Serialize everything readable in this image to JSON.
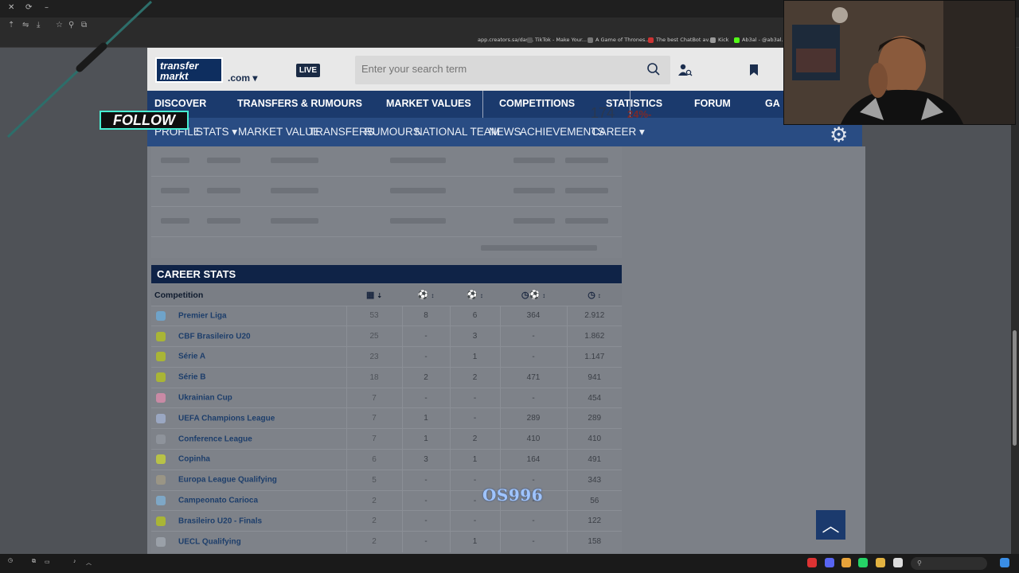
{
  "browser": {
    "bookmarks": [
      "app.creators.sa/das...",
      "TikTok - Make Your...",
      "A Game of Thrones...",
      "The best ChatBot av...",
      "Kick",
      "Ab3al - @ab3al..."
    ]
  },
  "header": {
    "logo_line1": "transfer",
    "logo_line2": "markt",
    "domain": ".com",
    "live_label": "LIVE",
    "search_placeholder": "Enter your search term"
  },
  "main_nav": [
    "DISCOVER",
    "TRANSFERS & RUMOURS",
    "MARKET VALUES",
    "COMPETITIONS",
    "STATISTICS",
    "FORUM",
    "GA"
  ],
  "sub_nav": [
    "PROFILE",
    "STATS ▾",
    "MARKET VALUE",
    "TRANSFERS",
    "RUMOURS",
    "NATIONAL TEAM",
    "NEWS",
    "ACHIEVEMENTS",
    "CAREER ▾"
  ],
  "overlay": {
    "follow_label": "FOLLOW",
    "watermark": "OS996",
    "ad_number": "174",
    "ad_percent": "24%-"
  },
  "career_stats": {
    "title": "CAREER STATS",
    "column_header": "Competition",
    "rows": [
      {
        "name": "Premier Liga",
        "apps": "53",
        "goals": "8",
        "assists": "6",
        "mpg": "364",
        "minutes": "2.912",
        "color": "#6fa3c9"
      },
      {
        "name": "CBF Brasileiro U20",
        "apps": "25",
        "goals": "-",
        "assists": "3",
        "mpg": "-",
        "minutes": "1.862",
        "color": "#a9b536"
      },
      {
        "name": "Série A",
        "apps": "23",
        "goals": "-",
        "assists": "1",
        "mpg": "-",
        "minutes": "1.147",
        "color": "#a9b536"
      },
      {
        "name": "Série B",
        "apps": "18",
        "goals": "2",
        "assists": "2",
        "mpg": "471",
        "minutes": "941",
        "color": "#a9b536"
      },
      {
        "name": "Ukrainian Cup",
        "apps": "7",
        "goals": "-",
        "assists": "-",
        "mpg": "-",
        "minutes": "454",
        "color": "#c98aa5"
      },
      {
        "name": "UEFA Champions League",
        "apps": "7",
        "goals": "1",
        "assists": "-",
        "mpg": "289",
        "minutes": "289",
        "color": "#9aa7c2"
      },
      {
        "name": "Conference League",
        "apps": "7",
        "goals": "1",
        "assists": "2",
        "mpg": "410",
        "minutes": "410",
        "color": "#8e939b"
      },
      {
        "name": "Copinha",
        "apps": "6",
        "goals": "3",
        "assists": "1",
        "mpg": "164",
        "minutes": "491",
        "color": "#b8c247"
      },
      {
        "name": "Europa League Qualifying",
        "apps": "5",
        "goals": "-",
        "assists": "-",
        "mpg": "-",
        "minutes": "343",
        "color": "#9a9585"
      },
      {
        "name": "Campeonato Carioca",
        "apps": "2",
        "goals": "-",
        "assists": "-",
        "mpg": "-",
        "minutes": "56",
        "color": "#7ea7c6"
      },
      {
        "name": "Brasileiro U20 - Finals",
        "apps": "2",
        "goals": "-",
        "assists": "-",
        "mpg": "-",
        "minutes": "122",
        "color": "#a9b536"
      },
      {
        "name": "UECL Qualifying",
        "apps": "2",
        "goals": "-",
        "assists": "1",
        "mpg": "-",
        "minutes": "158",
        "color": "#9aa0a8"
      }
    ]
  },
  "icons": {
    "apps": "squad-icon",
    "goals": "ball-icon",
    "assists": "assist-icon",
    "mpg": "clock-ball-icon",
    "minutes": "clock-icon"
  }
}
